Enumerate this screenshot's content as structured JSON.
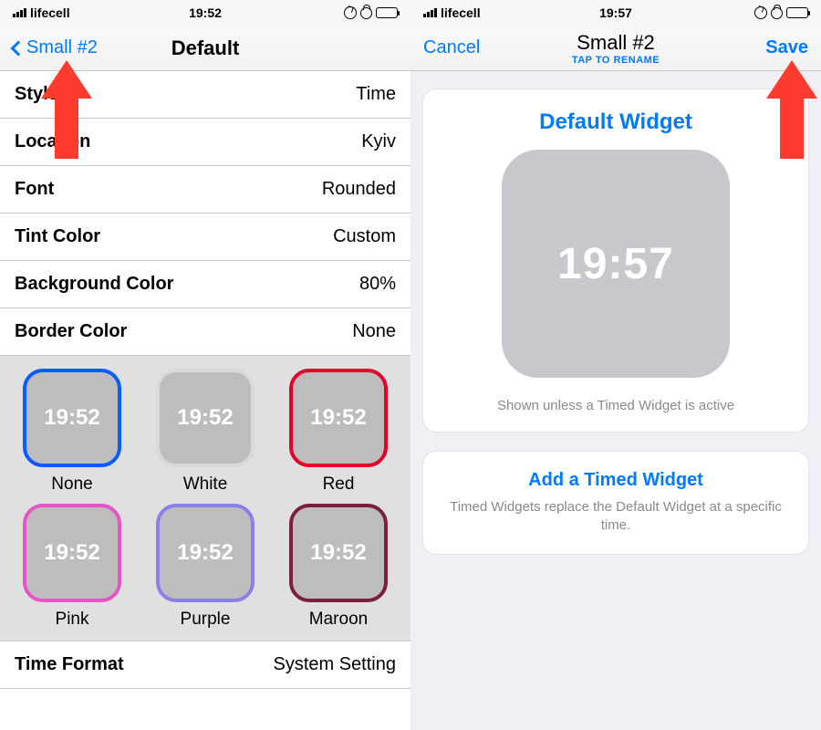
{
  "left": {
    "status": {
      "carrier": "lifecell",
      "time": "19:52"
    },
    "nav": {
      "back": "Small #2",
      "title": "Default"
    },
    "rows": [
      {
        "label": "Style",
        "value": "Time"
      },
      {
        "label": "Location",
        "value": "Kyiv"
      },
      {
        "label": "Font",
        "value": "Rounded"
      },
      {
        "label": "Tint Color",
        "value": "Custom"
      },
      {
        "label": "Background Color",
        "value": "80%"
      },
      {
        "label": "Border Color",
        "value": "None"
      }
    ],
    "swatches": [
      {
        "name": "None",
        "color": "#0a5cff",
        "time": "19:52"
      },
      {
        "name": "White",
        "color": "#d9d9d9",
        "time": "19:52"
      },
      {
        "name": "Red",
        "color": "#e4002b",
        "time": "19:52"
      },
      {
        "name": "Pink",
        "color": "#e754c4",
        "time": "19:52"
      },
      {
        "name": "Purple",
        "color": "#8b7fe8",
        "time": "19:52"
      },
      {
        "name": "Maroon",
        "color": "#7a1f3d",
        "time": "19:52"
      }
    ],
    "footer": {
      "label": "Time Format",
      "value": "System Setting"
    }
  },
  "right": {
    "status": {
      "carrier": "lifecell",
      "time": "19:57"
    },
    "nav": {
      "cancel": "Cancel",
      "title": "Small #2",
      "subtitle": "TAP TO RENAME",
      "save": "Save"
    },
    "card1": {
      "title": "Default Widget",
      "preview_time": "19:57",
      "caption": "Shown unless a Timed Widget is active"
    },
    "card2": {
      "title": "Add a Timed Widget",
      "desc": "Timed Widgets replace the Default Widget at a specific time."
    }
  }
}
